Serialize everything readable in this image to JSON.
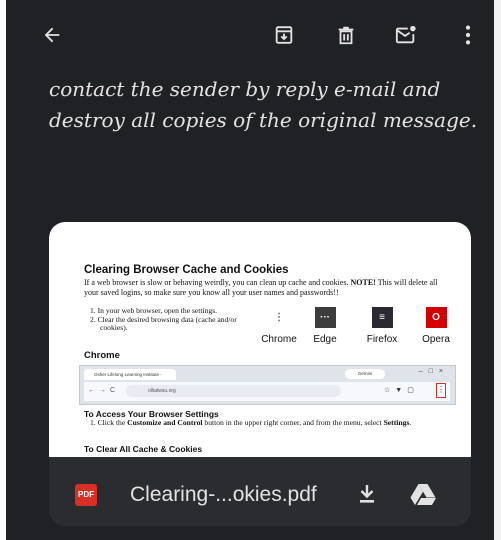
{
  "toolbar": {
    "back_icon": "arrow-left-icon",
    "archive_icon": "archive-icon",
    "delete_icon": "trash-icon",
    "mark_unread_icon": "mark-unread-icon",
    "more_icon": "more-vert-icon"
  },
  "email": {
    "body_lines": [
      "contact the sender by reply e-mail and",
      "destroy all copies of the original message."
    ]
  },
  "attachment": {
    "file_type_badge": "PDF",
    "file_name": "Clearing-...okies.pdf",
    "download_icon": "download-icon",
    "drive_icon": "google-drive-icon",
    "preview": {
      "title": "Clearing Browser Cache and Cookies",
      "intro_lead": "If a web browser is slow or behaving weirdly, you can clean up cache and cookies. ",
      "intro_note": "NOTE!",
      "intro_rest": " This will delete all your saved logins, so make sure you know all your user names and passwords!!",
      "steps": [
        "1.  In your web browser, open the settings.",
        "2.  Clear the desired browsing data (cache and/or cookies)."
      ],
      "browsers": [
        "Chrome",
        "Edge",
        "Firefox",
        "Opera"
      ],
      "section_chrome": "Chrome",
      "browser_tab": "Osher Lifelong Learning Institute -",
      "browser_gemini": "Gemini",
      "browser_url": "olliatwsu.org",
      "section_settings": "To Access Your Browser Settings",
      "settings_step_a": "1.  Click the ",
      "settings_step_b": "Customize and Control",
      "settings_step_c": " button in the upper right corner, and from the menu, select ",
      "settings_step_d": "Settings",
      "settings_step_e": ".",
      "section_clear": "To Clear All Cache & Cookies"
    }
  },
  "colors": {
    "background": "#202124",
    "text": "#e3e3e3",
    "card_footer": "#2b2c2f",
    "pdf_red": "#d93025"
  }
}
